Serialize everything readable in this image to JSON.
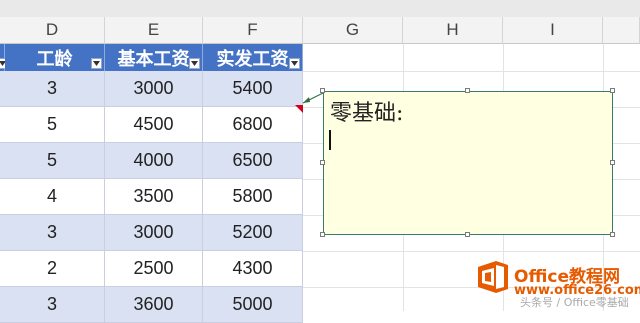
{
  "columns": [
    "D",
    "E",
    "F",
    "G",
    "H",
    "I"
  ],
  "table": {
    "headers": [
      "工龄",
      "基本工资",
      "实发工资"
    ],
    "rows": [
      [
        "3",
        "3000",
        "5400"
      ],
      [
        "5",
        "4500",
        "6800"
      ],
      [
        "5",
        "4000",
        "6500"
      ],
      [
        "4",
        "3500",
        "5800"
      ],
      [
        "3",
        "3000",
        "5200"
      ],
      [
        "2",
        "2500",
        "4300"
      ],
      [
        "3",
        "3600",
        "5000"
      ]
    ]
  },
  "comment": {
    "text": "零基础:"
  },
  "brand": {
    "line1": "Office教程网",
    "line2": "www.office26.com"
  },
  "watermark": "头条号 / Office零基础",
  "colors": {
    "header_bg": "#4472c4",
    "band": "#d9e1f2",
    "comment_bg": "#ffffe1",
    "brand": "#e65a00"
  }
}
